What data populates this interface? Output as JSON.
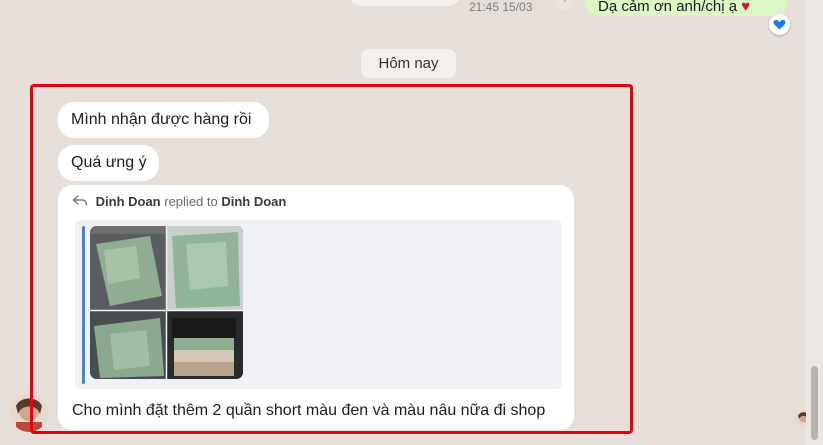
{
  "previous": {
    "time": "21:45 15/03",
    "right_text": "Dạ cảm ơn anh/chị ạ",
    "reaction_icon": "heart-icon",
    "reaction_color": "#1877f2"
  },
  "date_divider": "Hôm nay",
  "messages": {
    "m1": "Mình nhận được hàng rồi",
    "m2": "Quá ưng ý",
    "reply": {
      "author": "Dinh Doan",
      "verb": "replied to",
      "target": "Dinh Doan",
      "quoted_image": "product-photo-collage",
      "text": "Cho mình đặt thêm 2 quần short màu đen và màu nâu nữa đi shop"
    }
  },
  "colors": {
    "background": "#e6ded8",
    "incoming_bubble": "#ffffff",
    "outgoing_bubble": "#dcf6c4",
    "highlight": "#e3000f",
    "quote_bar": "#4a82c3"
  }
}
